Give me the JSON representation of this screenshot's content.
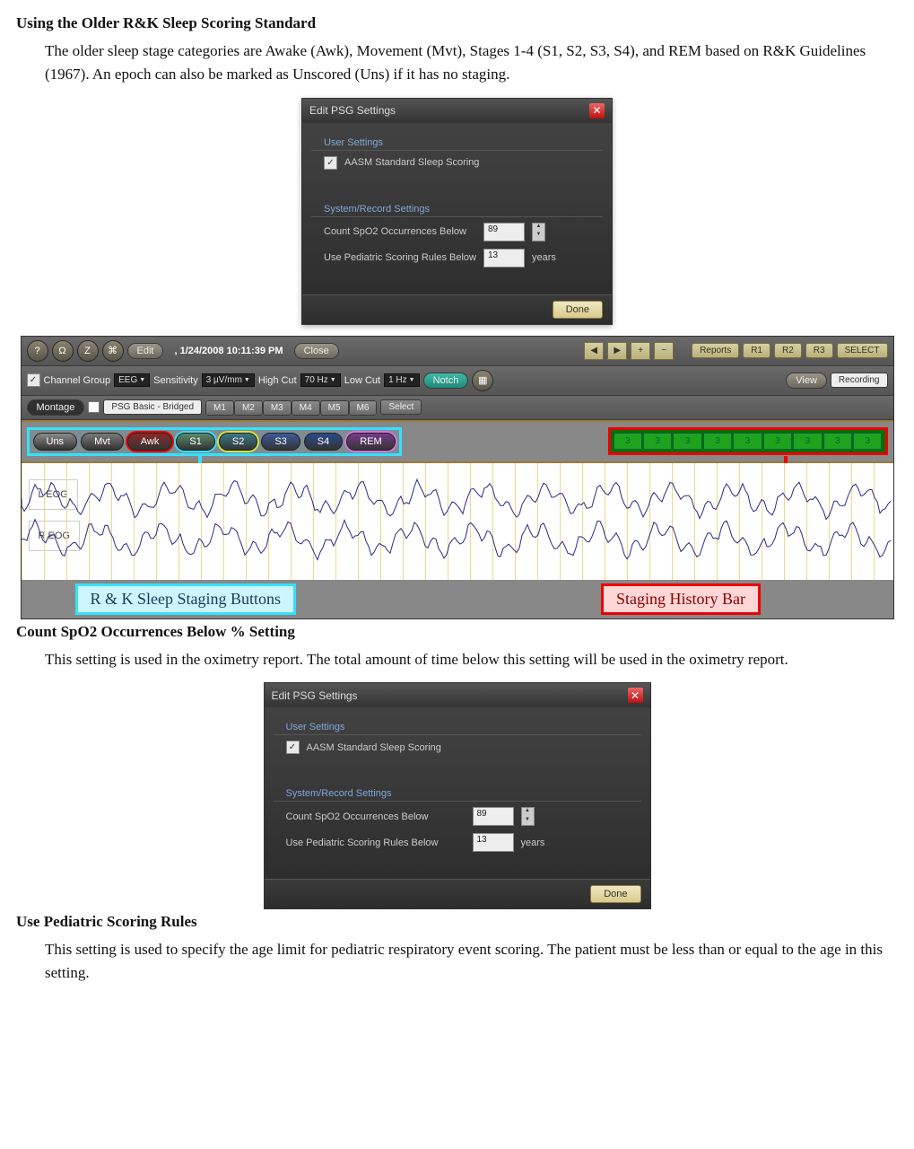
{
  "s1": {
    "h": "Using the Older R&K Sleep Scoring Standard",
    "p": "The older sleep stage categories are Awake (Awk), Movement (Mvt), Stages 1-4 (S1, S2, S3, S4), and REM based on R&K Guidelines (1967). An epoch can also be marked as Unscored (Uns) if it has no staging."
  },
  "dlg": {
    "title": "Edit PSG Settings",
    "sec1": "User Settings",
    "chk": "AASM Standard Sleep Scoring",
    "sec2": "System/Record Settings",
    "r1": "Count SpO2 Occurrences Below",
    "v1": "89",
    "r2": "Use Pediatric Scoring Rules Below",
    "v2": "13",
    "un": "years",
    "done": "Done"
  },
  "tb": {
    "edit": "Edit",
    "date": ", 1/24/2008 10:11:39 PM",
    "close": "Close",
    "reports": "Reports",
    "r1": "R1",
    "r2": "R2",
    "r3": "R3",
    "sel": "SELECT",
    "cg": "Channel Group",
    "eeg": "EEG",
    "sens": "Sensitivity",
    "sv": "3 µV/mm",
    "hc": "High Cut",
    "hv": "70 Hz",
    "lc": "Low Cut",
    "lv": "1 Hz",
    "notch": "Notch",
    "view": "View",
    "rec": "Recording",
    "mont": "Montage",
    "mname": "PSG Basic - Bridged",
    "m": [
      "M1",
      "M2",
      "M3",
      "M4",
      "M5",
      "M6"
    ],
    "msel": "Select"
  },
  "stage": {
    "btns": [
      {
        "l": "Uns",
        "c": "#8a8a8a"
      },
      {
        "l": "Mvt",
        "c": "#7a7a7a"
      },
      {
        "l": "Awk",
        "c": "#8a2a2a",
        "hl": "#e00"
      },
      {
        "l": "S1",
        "c": "#5a8a6a",
        "hl": "#34e1ff"
      },
      {
        "l": "S2",
        "c": "#3a7a8a",
        "hl": "#d8e23a"
      },
      {
        "l": "S3",
        "c": "#3a5a9a"
      },
      {
        "l": "S4",
        "c": "#2a4a8a"
      },
      {
        "l": "REM",
        "c": "#7a3a8a",
        "hl": "#d673e2"
      }
    ],
    "hist": [
      "3",
      "3",
      "3",
      "3",
      "3",
      "3",
      "3",
      "3",
      "3"
    ]
  },
  "ch": [
    "L EOG",
    "R EOG"
  ],
  "cap": {
    "a": "R & K Sleep Staging Buttons",
    "b": "Staging History Bar"
  },
  "s2": {
    "h": "Count SpO2 Occurrences Below % Setting",
    "p": "This setting is used in the oximetry report. The total amount of time below this setting will be used in the oximetry report."
  },
  "s3": {
    "h": "Use Pediatric Scoring Rules",
    "p": "This setting is used to specify the age limit for pediatric respiratory event scoring.  The patient must be less than or equal to the age in this setting."
  }
}
